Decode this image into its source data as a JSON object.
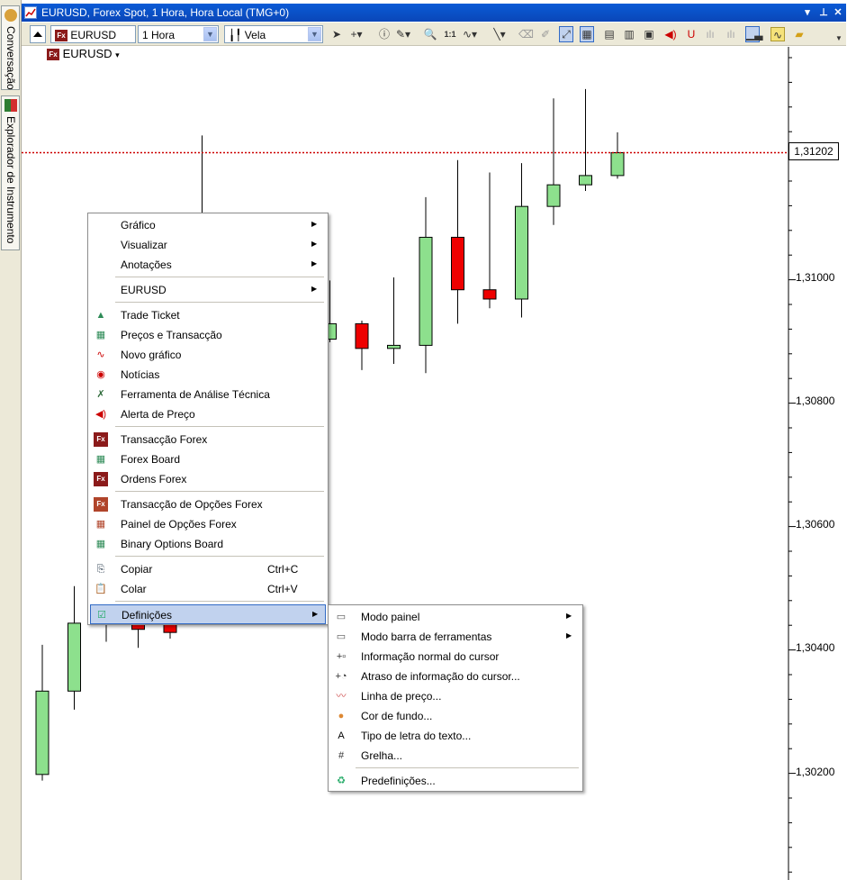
{
  "window": {
    "title": "EURUSD, Forex Spot, 1 Hora, Hora Local (TMG+0)",
    "icon": "chart-window-icon"
  },
  "dock": {
    "tab1": "Conversação",
    "tab2": "Explorador de Instrumento"
  },
  "toolbar": {
    "instrument": "EURUSD",
    "period": "1 Hora",
    "chart_type": "Vela",
    "icons": [
      "cursor-icon",
      "crosshair-icon",
      "info-icon",
      "drawing-icon",
      "zoom-icon",
      "one-to-one-icon",
      "indicator-icon",
      "line-icon",
      "eraser-icon",
      "pencil-icon",
      "pointer-mode-icon",
      "pattern-icon",
      "chart-a-icon",
      "chart-b-icon",
      "chart-c-icon",
      "sound-icon",
      "magnet-icon",
      "bars-icon",
      "bars2-icon",
      "volume-icon",
      "sun-icon",
      "notes-icon"
    ]
  },
  "chart": {
    "symbol": "EURUSD",
    "current_price": "1,31202",
    "y_ticks": [
      "1,31000",
      "1,30800",
      "1,30600",
      "1,30400",
      "1,30200"
    ],
    "colors": {
      "up": "#8de08d",
      "down": "#ee0000",
      "price_line": "#cc0000"
    }
  },
  "chart_data": {
    "type": "candlestick",
    "title": "EURUSD",
    "ylabel": "",
    "ylim": [
      1.3007,
      1.3142
    ],
    "candles": [
      {
        "o": 1.30195,
        "h": 1.30405,
        "l": 1.30185,
        "c": 1.3033
      },
      {
        "o": 1.3033,
        "h": 1.305,
        "l": 1.303,
        "c": 1.3044
      },
      {
        "o": 1.3047,
        "h": 1.3052,
        "l": 1.3041,
        "c": 1.3049
      },
      {
        "o": 1.3044,
        "h": 1.3046,
        "l": 1.304,
        "c": 1.3043
      },
      {
        "o": 1.3045,
        "h": 1.30465,
        "l": 1.30415,
        "c": 1.30425
      },
      {
        "o": 1.31,
        "h": 1.3123,
        "l": 1.3096,
        "c": 1.31
      },
      {
        "o": 1.3105,
        "h": 1.31065,
        "l": 1.30915,
        "c": 1.30935
      },
      {
        "o": 1.30935,
        "h": 1.3109,
        "l": 1.3093,
        "c": 1.3096
      },
      {
        "o": 1.30965,
        "h": 1.31035,
        "l": 1.30895,
        "c": 1.309
      },
      {
        "o": 1.309,
        "h": 1.30995,
        "l": 1.30895,
        "c": 1.30925
      },
      {
        "o": 1.30925,
        "h": 1.3093,
        "l": 1.3085,
        "c": 1.30885
      },
      {
        "o": 1.30885,
        "h": 1.31,
        "l": 1.3086,
        "c": 1.3089
      },
      {
        "o": 1.3089,
        "h": 1.3113,
        "l": 1.30845,
        "c": 1.31065
      },
      {
        "o": 1.31065,
        "h": 1.3119,
        "l": 1.30925,
        "c": 1.3098
      },
      {
        "o": 1.3098,
        "h": 1.3117,
        "l": 1.3095,
        "c": 1.30965
      },
      {
        "o": 1.30965,
        "h": 1.31185,
        "l": 1.30935,
        "c": 1.31115
      },
      {
        "o": 1.31115,
        "h": 1.3129,
        "l": 1.31085,
        "c": 1.3115
      },
      {
        "o": 1.3115,
        "h": 1.31305,
        "l": 1.3114,
        "c": 1.31165
      },
      {
        "o": 1.31165,
        "h": 1.31235,
        "l": 1.3116,
        "c": 1.31202
      }
    ],
    "current_price": 1.31202
  },
  "menu": {
    "items": [
      {
        "label": "Gráfico",
        "submenu": true,
        "icon": ""
      },
      {
        "label": "Visualizar",
        "submenu": true,
        "icon": ""
      },
      {
        "label": "Anotações",
        "submenu": true,
        "icon": ""
      },
      {
        "sep": true
      },
      {
        "label": "EURUSD",
        "submenu": true,
        "icon": ""
      },
      {
        "sep": true
      },
      {
        "label": "Trade Ticket",
        "icon": "trade-ticket-icon"
      },
      {
        "label": "Preços e Transacção",
        "icon": "prices-icon"
      },
      {
        "label": "Novo gráfico",
        "icon": "new-chart-icon"
      },
      {
        "label": "Notícias",
        "icon": "news-icon"
      },
      {
        "label": "Ferramenta de Análise Técnica",
        "icon": "analysis-tool-icon"
      },
      {
        "label": "Alerta de Preço",
        "icon": "price-alert-icon"
      },
      {
        "sep": true
      },
      {
        "label": "Transacção Forex",
        "icon": "fx-trade-icon"
      },
      {
        "label": "Forex Board",
        "icon": "forex-board-icon"
      },
      {
        "label": "Ordens Forex",
        "icon": "fx-orders-icon"
      },
      {
        "sep": true
      },
      {
        "label": "Transacção de Opções Forex",
        "icon": "fx-options-trade-icon"
      },
      {
        "label": "Painel de Opções Forex",
        "icon": "fx-options-panel-icon"
      },
      {
        "label": "Binary Options Board",
        "icon": "binary-options-icon"
      },
      {
        "sep": true
      },
      {
        "label": "Copiar",
        "shortcut": "Ctrl+C",
        "icon": "copy-icon"
      },
      {
        "label": "Colar",
        "shortcut": "Ctrl+V",
        "icon": "paste-icon"
      },
      {
        "sep": true
      },
      {
        "label": "Definições",
        "submenu": true,
        "icon": "settings-icon",
        "highlighted": true
      }
    ]
  },
  "submenu": {
    "items": [
      {
        "label": "Modo painel",
        "submenu": true,
        "icon": "panel-mode-icon"
      },
      {
        "label": "Modo barra de ferramentas",
        "submenu": true,
        "icon": "toolbar-mode-icon"
      },
      {
        "label": "Informação normal do cursor",
        "icon": "cursor-info-icon"
      },
      {
        "label": "Atraso de informação do cursor...",
        "icon": "cursor-delay-icon"
      },
      {
        "label": "Linha de preço...",
        "icon": "price-line-icon"
      },
      {
        "label": "Cor de fundo...",
        "icon": "background-color-icon"
      },
      {
        "label": "Tipo de letra do texto...",
        "icon": "font-icon"
      },
      {
        "label": "Grelha...",
        "icon": "grid-icon"
      },
      {
        "sep": true
      },
      {
        "label": "Predefinições...",
        "icon": "defaults-icon"
      }
    ]
  }
}
